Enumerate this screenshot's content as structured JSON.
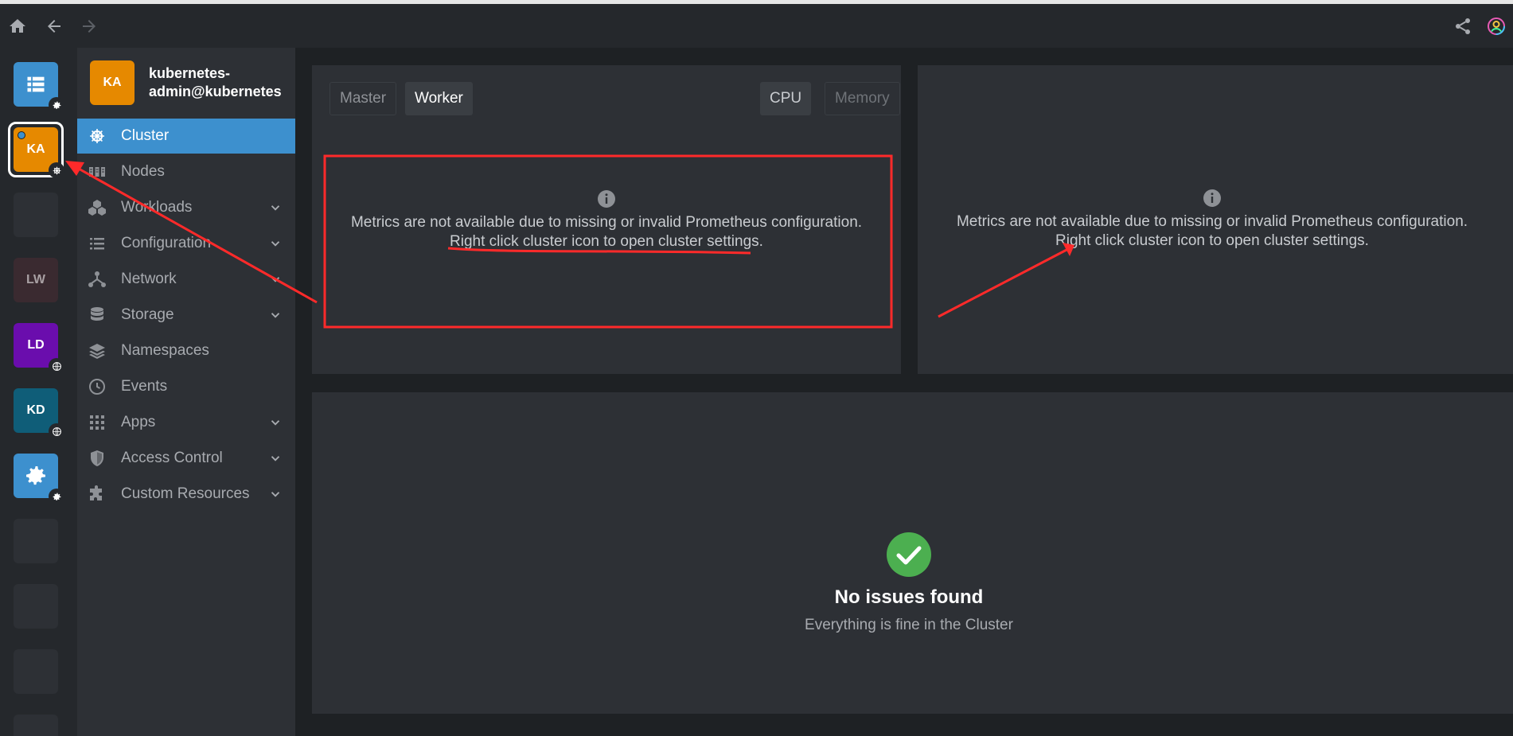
{
  "topbar": {
    "home_icon": "home-icon",
    "back_icon": "arrow-left-icon",
    "forward_icon": "arrow-right-icon",
    "share_icon": "share-icon",
    "account_icon": "user-circle-icon"
  },
  "hotbar": {
    "items": [
      {
        "label": "",
        "color": "#3d90ce",
        "icon": "catalog-icon",
        "badge": "gear-icon"
      },
      {
        "label": "KA",
        "color": "#e68900",
        "badge": "helm-icon",
        "active": true
      },
      {
        "label": "",
        "color": "#2d3035"
      },
      {
        "label": "LW",
        "color": "#3a2a30"
      },
      {
        "label": "LD",
        "color": "#6a0dad",
        "badge": "globe-icon"
      },
      {
        "label": "KD",
        "color": "#0f5d78",
        "badge": "globe-icon"
      },
      {
        "label": "",
        "color": "#3d90ce",
        "icon": "settings-icon",
        "badge": "gear-icon"
      }
    ]
  },
  "cluster": {
    "avatar": "KA",
    "name": "kubernetes-admin@kubernetes"
  },
  "nav": [
    {
      "label": "Cluster",
      "icon": "helm-icon",
      "active": true
    },
    {
      "label": "Nodes",
      "icon": "nodes-icon"
    },
    {
      "label": "Workloads",
      "icon": "cubes-icon",
      "expandable": true
    },
    {
      "label": "Configuration",
      "icon": "list-icon",
      "expandable": true
    },
    {
      "label": "Network",
      "icon": "network-icon",
      "expandable": true
    },
    {
      "label": "Storage",
      "icon": "database-icon",
      "expandable": true
    },
    {
      "label": "Namespaces",
      "icon": "layers-icon"
    },
    {
      "label": "Events",
      "icon": "clock-icon"
    },
    {
      "label": "Apps",
      "icon": "grid-icon",
      "expandable": true
    },
    {
      "label": "Access Control",
      "icon": "shield-icon",
      "expandable": true
    },
    {
      "label": "Custom Resources",
      "icon": "puzzle-icon",
      "expandable": true
    }
  ],
  "metrics_panel": {
    "tabs": {
      "master": "Master",
      "worker": "Worker",
      "cpu": "CPU",
      "memory": "Memory"
    },
    "message_line1": "Metrics are not available due to missing or invalid Prometheus configuration.",
    "message_line2": "Right click cluster icon to open cluster settings."
  },
  "metrics_panel_right": {
    "message_line1": "Metrics are not available due to missing or invalid Prometheus configuration.",
    "message_line2": "Right click cluster icon to open cluster settings."
  },
  "issues": {
    "title": "No issues found",
    "subtitle": "Everything is fine in the Cluster"
  },
  "colors": {
    "accent": "#3d90ce",
    "annotation": "#ff2a2a",
    "success": "#4caf50"
  }
}
